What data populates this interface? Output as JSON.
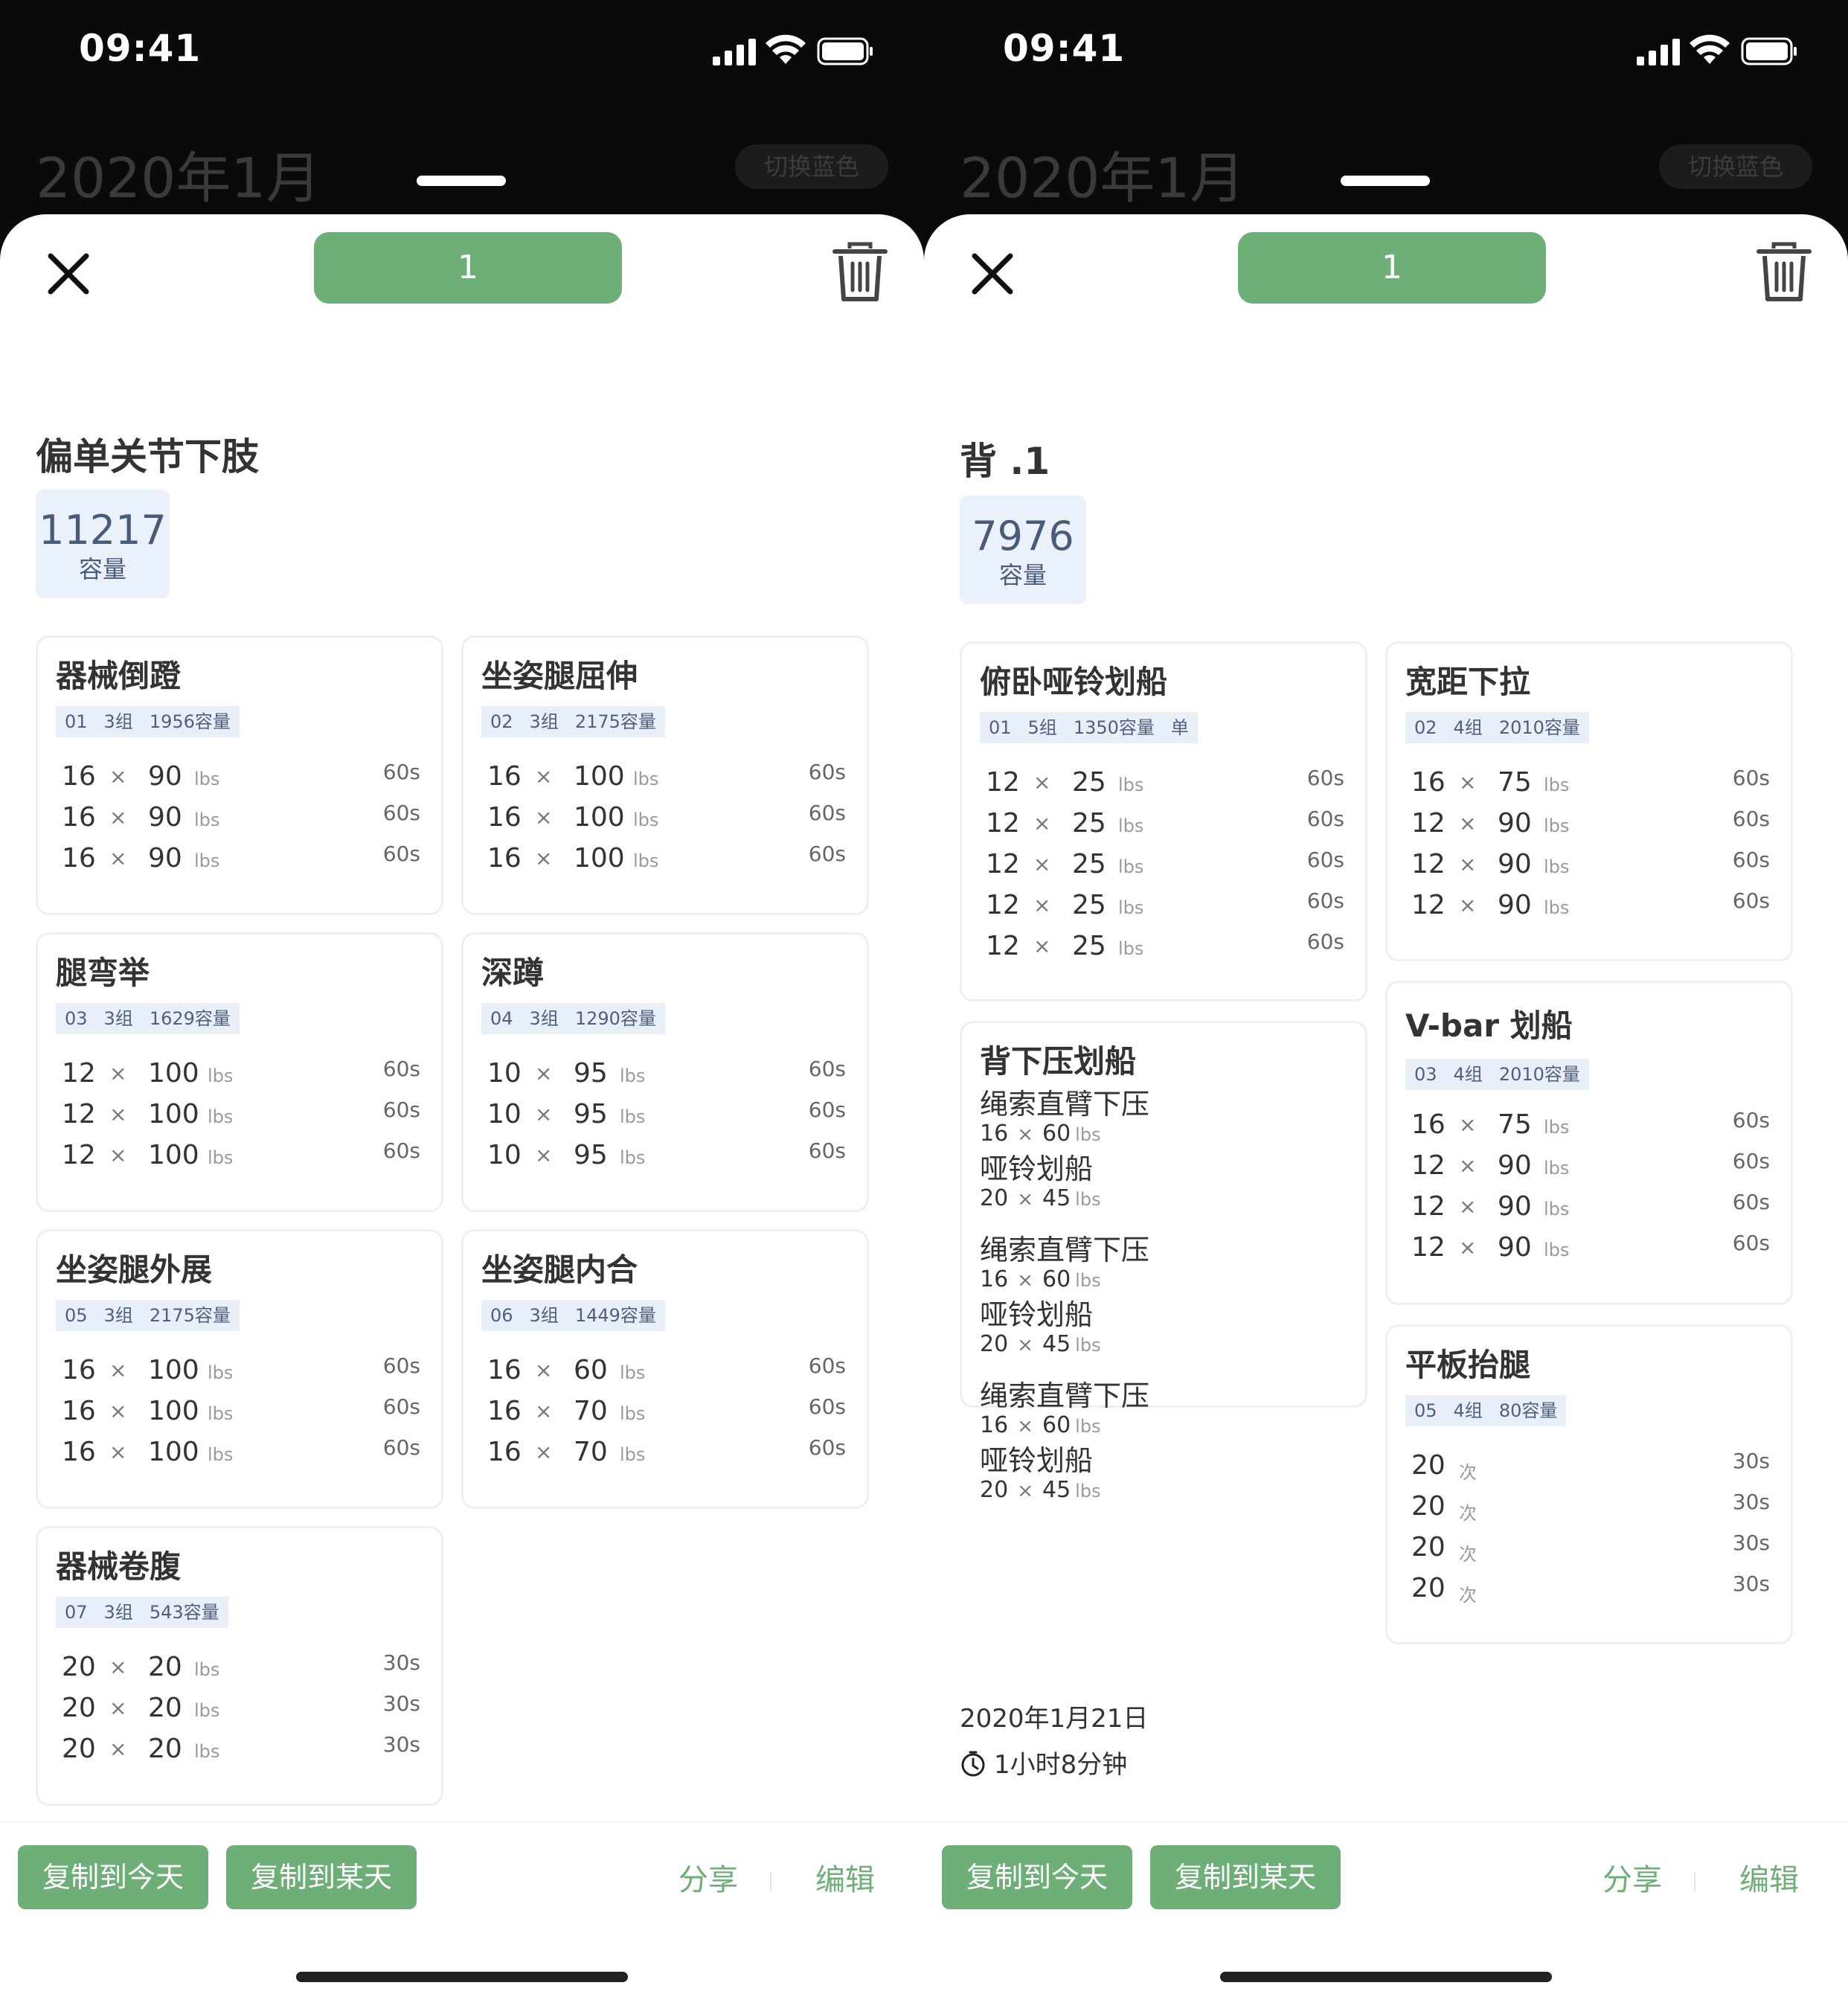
{
  "screens": [
    {
      "status_time": "09:41",
      "bg_title": "2020年1月",
      "bg_button": "切换蓝色",
      "day_pill": "1",
      "workout_title": "偏单关节下肢",
      "volume": {
        "value": "11217",
        "label": "容量"
      },
      "cards": [
        {
          "name": "器械倒蹬",
          "tag": [
            "01",
            "3组",
            "1956容量"
          ],
          "sets": [
            {
              "reps": "16",
              "x": "×",
              "w": "90",
              "u": "lbs",
              "rest": "60s"
            },
            {
              "reps": "16",
              "x": "×",
              "w": "90",
              "u": "lbs",
              "rest": "60s"
            },
            {
              "reps": "16",
              "x": "×",
              "w": "90",
              "u": "lbs",
              "rest": "60s"
            }
          ]
        },
        {
          "name": "坐姿腿屈伸",
          "tag": [
            "02",
            "3组",
            "2175容量"
          ],
          "sets": [
            {
              "reps": "16",
              "x": "×",
              "w": "100",
              "u": "lbs",
              "rest": "60s"
            },
            {
              "reps": "16",
              "x": "×",
              "w": "100",
              "u": "lbs",
              "rest": "60s"
            },
            {
              "reps": "16",
              "x": "×",
              "w": "100",
              "u": "lbs",
              "rest": "60s"
            }
          ]
        },
        {
          "name": "腿弯举",
          "tag": [
            "03",
            "3组",
            "1629容量"
          ],
          "sets": [
            {
              "reps": "12",
              "x": "×",
              "w": "100",
              "u": "lbs",
              "rest": "60s"
            },
            {
              "reps": "12",
              "x": "×",
              "w": "100",
              "u": "lbs",
              "rest": "60s"
            },
            {
              "reps": "12",
              "x": "×",
              "w": "100",
              "u": "lbs",
              "rest": "60s"
            }
          ]
        },
        {
          "name": "深蹲",
          "tag": [
            "04",
            "3组",
            "1290容量"
          ],
          "sets": [
            {
              "reps": "10",
              "x": "×",
              "w": "95",
              "u": "lbs",
              "rest": "60s"
            },
            {
              "reps": "10",
              "x": "×",
              "w": "95",
              "u": "lbs",
              "rest": "60s"
            },
            {
              "reps": "10",
              "x": "×",
              "w": "95",
              "u": "lbs",
              "rest": "60s"
            }
          ]
        },
        {
          "name": "坐姿腿外展",
          "tag": [
            "05",
            "3组",
            "2175容量"
          ],
          "sets": [
            {
              "reps": "16",
              "x": "×",
              "w": "100",
              "u": "lbs",
              "rest": "60s"
            },
            {
              "reps": "16",
              "x": "×",
              "w": "100",
              "u": "lbs",
              "rest": "60s"
            },
            {
              "reps": "16",
              "x": "×",
              "w": "100",
              "u": "lbs",
              "rest": "60s"
            }
          ]
        },
        {
          "name": "坐姿腿内合",
          "tag": [
            "06",
            "3组",
            "1449容量"
          ],
          "sets": [
            {
              "reps": "16",
              "x": "×",
              "w": "60",
              "u": "lbs",
              "rest": "60s"
            },
            {
              "reps": "16",
              "x": "×",
              "w": "70",
              "u": "lbs",
              "rest": "60s"
            },
            {
              "reps": "16",
              "x": "×",
              "w": "70",
              "u": "lbs",
              "rest": "60s"
            }
          ]
        },
        {
          "name": "器械卷腹",
          "tag": [
            "07",
            "3组",
            "543容量"
          ],
          "sets": [
            {
              "reps": "20",
              "x": "×",
              "w": "20",
              "u": "lbs",
              "rest": "30s"
            },
            {
              "reps": "20",
              "x": "×",
              "w": "20",
              "u": "lbs",
              "rest": "30s"
            },
            {
              "reps": "20",
              "x": "×",
              "w": "20",
              "u": "lbs",
              "rest": "30s"
            }
          ]
        }
      ],
      "bottom": {
        "copy_today": "复制到今天",
        "copy_someday": "复制到某天",
        "share": "分享",
        "edit": "编辑"
      }
    },
    {
      "status_time": "09:41",
      "bg_title": "2020年1月",
      "bg_button": "切换蓝色",
      "day_pill": "1",
      "workout_title": "背 .1",
      "volume": {
        "value": "7976",
        "label": "容量"
      },
      "cards": [
        {
          "name": "俯卧哑铃划船",
          "tag": [
            "01",
            "5组",
            "1350容量",
            "单"
          ],
          "sets": [
            {
              "reps": "12",
              "x": "×",
              "w": "25",
              "u": "lbs",
              "rest": "60s"
            },
            {
              "reps": "12",
              "x": "×",
              "w": "25",
              "u": "lbs",
              "rest": "60s"
            },
            {
              "reps": "12",
              "x": "×",
              "w": "25",
              "u": "lbs",
              "rest": "60s"
            },
            {
              "reps": "12",
              "x": "×",
              "w": "25",
              "u": "lbs",
              "rest": "60s"
            },
            {
              "reps": "12",
              "x": "×",
              "w": "25",
              "u": "lbs",
              "rest": "60s"
            }
          ]
        },
        {
          "name": "宽距下拉",
          "tag": [
            "02",
            "4组",
            "2010容量"
          ],
          "sets": [
            {
              "reps": "16",
              "x": "×",
              "w": "75",
              "u": "lbs",
              "rest": "60s"
            },
            {
              "reps": "12",
              "x": "×",
              "w": "90",
              "u": "lbs",
              "rest": "60s"
            },
            {
              "reps": "12",
              "x": "×",
              "w": "90",
              "u": "lbs",
              "rest": "60s"
            },
            {
              "reps": "12",
              "x": "×",
              "w": "90",
              "u": "lbs",
              "rest": "60s"
            }
          ]
        },
        {
          "name": "背下压划船",
          "supersets": [
            [
              {
                "name": "绳索直臂下压",
                "reps": "16",
                "x": "×",
                "w": "60",
                "u": "lbs"
              },
              {
                "name": "哑铃划船",
                "reps": "20",
                "x": "×",
                "w": "45",
                "u": "lbs"
              }
            ],
            [
              {
                "name": "绳索直臂下压",
                "reps": "16",
                "x": "×",
                "w": "60",
                "u": "lbs"
              },
              {
                "name": "哑铃划船",
                "reps": "20",
                "x": "×",
                "w": "45",
                "u": "lbs"
              }
            ],
            [
              {
                "name": "绳索直臂下压",
                "reps": "16",
                "x": "×",
                "w": "60",
                "u": "lbs"
              },
              {
                "name": "哑铃划船",
                "reps": "20",
                "x": "×",
                "w": "45",
                "u": "lbs"
              }
            ]
          ]
        },
        {
          "name": "V-bar 划船",
          "tag": [
            "03",
            "4组",
            "2010容量"
          ],
          "sets": [
            {
              "reps": "16",
              "x": "×",
              "w": "75",
              "u": "lbs",
              "rest": "60s"
            },
            {
              "reps": "12",
              "x": "×",
              "w": "90",
              "u": "lbs",
              "rest": "60s"
            },
            {
              "reps": "12",
              "x": "×",
              "w": "90",
              "u": "lbs",
              "rest": "60s"
            },
            {
              "reps": "12",
              "x": "×",
              "w": "90",
              "u": "lbs",
              "rest": "60s"
            }
          ]
        },
        {
          "name": "平板抬腿",
          "tag": [
            "05",
            "4组",
            "80容量"
          ],
          "sets": [
            {
              "reps": "20",
              "u": "次",
              "rest": "30s"
            },
            {
              "reps": "20",
              "u": "次",
              "rest": "30s"
            },
            {
              "reps": "20",
              "u": "次",
              "rest": "30s"
            },
            {
              "reps": "20",
              "u": "次",
              "rest": "30s"
            }
          ]
        }
      ],
      "date": "2020年1月21日",
      "duration": "1小时8分钟",
      "bottom": {
        "copy_today": "复制到今天",
        "copy_someday": "复制到某天",
        "share": "分享",
        "edit": "编辑"
      }
    }
  ]
}
